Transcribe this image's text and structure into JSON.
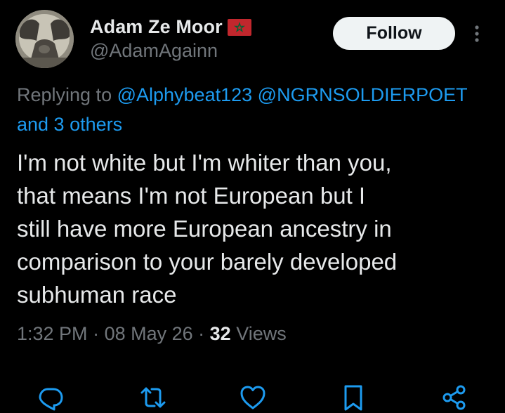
{
  "author": {
    "display_name": "Adam Ze Moor",
    "handle": "@AdamAgainn",
    "flag_icon": "morocco-flag-icon",
    "avatar_icon": "profile-avatar"
  },
  "header": {
    "follow_label": "Follow",
    "more_icon": "more-vertical-icon"
  },
  "reply_context": {
    "prefix": "Replying to ",
    "mentions": [
      "@Alphybeat123",
      "@NGRNSOLDIERPOET"
    ],
    "others": "and 3 others"
  },
  "tweet": {
    "lines": [
      "I'm not white but I'm whiter than you,",
      "that means I'm not European but I",
      "still have more European ancestry in",
      "comparison to your barely developed",
      "subhuman race"
    ]
  },
  "meta": {
    "time": "1:32 PM",
    "sep1": " · ",
    "date": "08 May 26",
    "sep2": " · ",
    "views_count": "32",
    "views_label": " Views"
  },
  "actions": [
    {
      "name": "reply",
      "icon": "reply-icon"
    },
    {
      "name": "repost",
      "icon": "repost-icon"
    },
    {
      "name": "like",
      "icon": "like-icon"
    },
    {
      "name": "bookmark",
      "icon": "bookmark-icon"
    },
    {
      "name": "share",
      "icon": "share-icon"
    }
  ],
  "colors": {
    "background": "#000000",
    "text_primary": "#e7e9ea",
    "text_secondary": "#71767b",
    "link": "#1d9bf0",
    "follow_bg": "#eff3f4",
    "follow_text": "#0f1419",
    "action_icon": "#1d9bf0"
  }
}
